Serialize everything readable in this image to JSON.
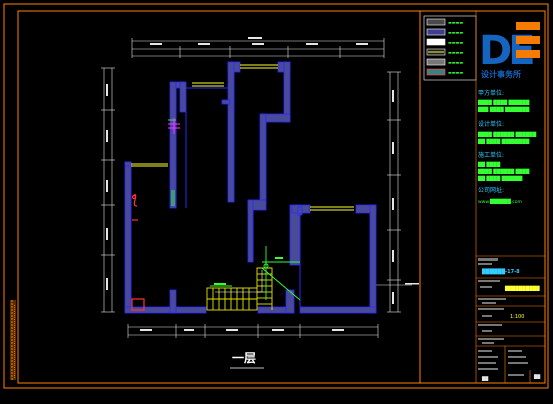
{
  "drawing": {
    "title": "一层"
  },
  "legend": {
    "items": [
      {
        "swatch": "#4a4a4a",
        "border": "#ffffff",
        "stripe": "",
        "label": "▬▬▬▬"
      },
      {
        "swatch": "#3f3f8f",
        "border": "#ffffff",
        "stripe": "",
        "label": "▬▬▬▬"
      },
      {
        "swatch": "#ffffff",
        "border": "#ffffff",
        "stripe": "",
        "label": "▬▬▬▬"
      },
      {
        "swatch": "#1e1e1e",
        "border": "#ffffff",
        "stripe": "#ffff33",
        "label": "▬▬▬▬"
      },
      {
        "swatch": "#777777",
        "border": "#ffffff",
        "stripe": "",
        "label": "▬▬▬▬"
      },
      {
        "swatch": "#3f7f7f",
        "border": "#ff4d4d",
        "stripe": "",
        "label": "▬▬▬▬"
      }
    ]
  },
  "logo": {
    "letters": "DE",
    "caption": "设计事务所"
  },
  "titleblock": {
    "section_headings": [
      "甲方单位:",
      "设计单位:",
      "施工单位:",
      "公司网址:"
    ],
    "lines_1": [
      "████ ████ ██████",
      "███ ████ ███████"
    ],
    "lines_2": [
      "████ ██████ ██████",
      "██ ████ ████████"
    ],
    "lines_3": [
      "██ ████",
      "████ ██████ ████",
      "██ ████ ██████"
    ],
    "website": "www.██████.com",
    "project_no": "██████-17-8",
    "drawing_name": "██████████",
    "scale_value": "1:100",
    "footer_small_1": "██",
    "footer_small_2": "██"
  },
  "colors": {
    "frame": "#ff7f00",
    "wall_fill": "#4a4a9a",
    "wall_edge": "#2a2aff",
    "dimension": "#e6e6e6",
    "window": "#ffff33",
    "stair": "#e6e600",
    "annotation_green": "#33ff33",
    "annotation_red": "#ff3333",
    "logo_blue": "#1565c0",
    "logo_orange": "#f57c00"
  }
}
